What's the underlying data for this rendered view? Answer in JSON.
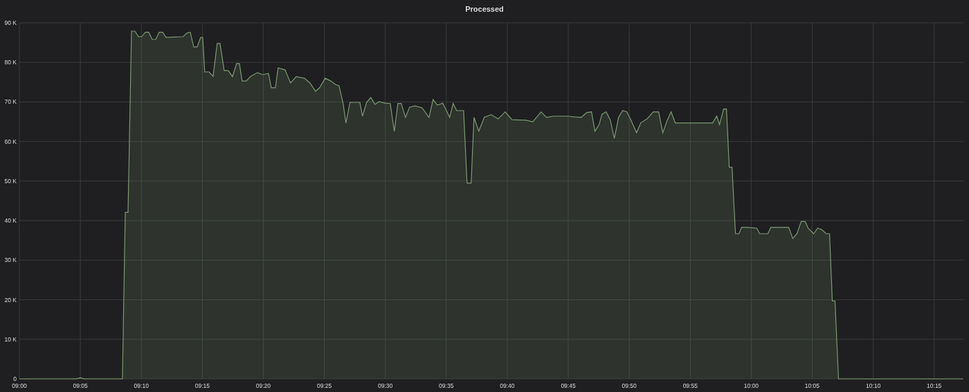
{
  "panel": {
    "chart_data": {
      "type": "area",
      "title": "Processed",
      "grid": true,
      "x": [
        9,
        9.0775,
        9.0832,
        9.0888,
        9.1408,
        9.1447,
        9.1485,
        9.1532,
        9.1578,
        9.1627,
        9.1673,
        9.172,
        9.1768,
        9.1815,
        9.1862,
        9.191,
        9.1957,
        9.2005,
        9.224,
        9.2288,
        9.2335,
        9.2382,
        9.243,
        9.2477,
        9.2505,
        9.2533,
        9.259,
        9.2647,
        9.2703,
        9.2742,
        9.2798,
        9.2855,
        9.2912,
        9.2968,
        9.3007,
        9.3043,
        9.31,
        9.3157,
        9.3252,
        9.3328,
        9.3403,
        9.3442,
        9.3498,
        9.3535,
        9.363,
        9.3705,
        9.3782,
        9.3895,
        9.397,
        9.4047,
        9.4103,
        9.4178,
        9.4253,
        9.432,
        9.4367,
        9.4423,
        9.4462,
        9.4518,
        9.4652,
        9.4688,
        9.4745,
        9.4802,
        9.4858,
        9.4915,
        9.4992,
        9.5067,
        9.5123,
        9.5172,
        9.5218,
        9.5275,
        9.5332,
        9.5407,
        9.5502,
        9.5597,
        9.5653,
        9.571,
        9.5785,
        9.588,
        9.5927,
        9.5975,
        9.607,
        9.6117,
        9.6173,
        9.6212,
        9.6277,
        9.6353,
        9.6447,
        9.6542,
        9.6637,
        9.6732,
        9.692,
        9.7015,
        9.7128,
        9.7203,
        9.7298,
        9.7487,
        9.7677,
        9.7752,
        9.7818,
        9.7865,
        9.7922,
        9.796,
        9.8017,
        9.8073,
        9.813,
        9.8187,
        9.8243,
        9.83,
        9.8357,
        9.8433,
        9.849,
        9.8575,
        9.866,
        9.8735,
        9.8792,
        9.8848,
        9.8905,
        9.8962,
        9.9188,
        9.9472,
        9.9528,
        9.9567,
        9.9623,
        9.9662,
        9.97,
        9.9737,
        9.9785,
        9.9832,
        9.987,
        9.9945,
        10.0077,
        10.0115,
        10.0228,
        10.0267,
        10.0512,
        10.0568,
        10.0625,
        10.0682,
        10.0738,
        10.0777,
        10.0852,
        10.0908,
        10.0965,
        10.1023,
        10.107,
        10.1108,
        10.1145,
        10.1193,
        10.2895
      ],
      "series": [
        {
          "color": "#7e9a74",
          "values": [
            0,
            0,
            300,
            0,
            0,
            42100,
            42100,
            87900,
            87900,
            86500,
            86500,
            87600,
            87600,
            85800,
            85800,
            87600,
            87600,
            86300,
            86500,
            87400,
            87600,
            83900,
            83900,
            86300,
            86300,
            77600,
            77600,
            76500,
            84800,
            84800,
            77900,
            77900,
            76400,
            79700,
            79700,
            75300,
            75300,
            76400,
            77400,
            76900,
            77200,
            73600,
            73600,
            78600,
            78100,
            74800,
            76400,
            76000,
            74800,
            72700,
            73600,
            76000,
            75300,
            74400,
            74100,
            69600,
            64700,
            69900,
            69900,
            66400,
            69900,
            71100,
            69400,
            70100,
            69700,
            69600,
            62600,
            69600,
            69600,
            66100,
            68700,
            69000,
            68500,
            66100,
            70600,
            69200,
            69700,
            66100,
            69600,
            67800,
            67800,
            49500,
            49500,
            66100,
            62600,
            66100,
            66800,
            65700,
            67500,
            65500,
            65400,
            65000,
            67500,
            66100,
            66400,
            66400,
            66100,
            67300,
            67500,
            62600,
            64300,
            66900,
            67500,
            65500,
            60800,
            66100,
            67800,
            67500,
            65400,
            62200,
            64700,
            65700,
            67500,
            67500,
            62200,
            65200,
            67500,
            64700,
            64700,
            64700,
            66400,
            64300,
            68200,
            68200,
            53500,
            53500,
            36700,
            36700,
            38300,
            38300,
            38100,
            36700,
            36700,
            38300,
            38300,
            35500,
            36700,
            39800,
            39800,
            38100,
            36700,
            38100,
            37700,
            36700,
            36700,
            19700,
            19700,
            0,
            0
          ]
        }
      ],
      "xlim": [
        9,
        10.29
      ],
      "ylim": [
        0,
        90000
      ],
      "xticks": [
        {
          "value": 9,
          "label": "09:00"
        },
        {
          "value": 9.0833,
          "label": "09:05"
        },
        {
          "value": 9.1667,
          "label": "09:10"
        },
        {
          "value": 9.25,
          "label": "09:15"
        },
        {
          "value": 9.3333,
          "label": "09:20"
        },
        {
          "value": 9.4167,
          "label": "09:25"
        },
        {
          "value": 9.5,
          "label": "09:30"
        },
        {
          "value": 9.5833,
          "label": "09:35"
        },
        {
          "value": 9.6667,
          "label": "09:40"
        },
        {
          "value": 9.75,
          "label": "09:45"
        },
        {
          "value": 9.8333,
          "label": "09:50"
        },
        {
          "value": 9.9167,
          "label": "09:55"
        },
        {
          "value": 10,
          "label": "10:00"
        },
        {
          "value": 10.0833,
          "label": "10:05"
        },
        {
          "value": 10.1667,
          "label": "10:10"
        },
        {
          "value": 10.25,
          "label": "10:15"
        }
      ],
      "yticks": [
        {
          "value": 0,
          "label": "0"
        },
        {
          "value": 10000,
          "label": "10 K"
        },
        {
          "value": 20000,
          "label": "20 K"
        },
        {
          "value": 30000,
          "label": "30 K"
        },
        {
          "value": 40000,
          "label": "40 K"
        },
        {
          "value": 50000,
          "label": "50 K"
        },
        {
          "value": 60000,
          "label": "60 K"
        },
        {
          "value": 70000,
          "label": "70 K"
        },
        {
          "value": 80000,
          "label": "80 K"
        },
        {
          "value": 90000,
          "label": "90 K"
        }
      ]
    }
  }
}
